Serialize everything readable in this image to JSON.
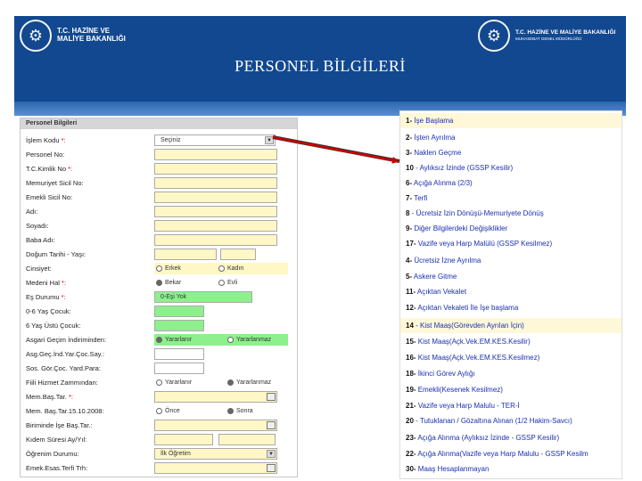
{
  "banner": {
    "left_logo_line1": "T.C. HAZİNE VE",
    "left_logo_line2": "MALİYE BAKANLIĞI",
    "right_logo_line1": "T.C. HAZİNE VE MALİYE BAKANLIĞI",
    "right_logo_line2": "MUHASEBAT GENEL MÜDÜRLÜĞÜ",
    "title": "PERSONEL BİLGİLERİ"
  },
  "form": {
    "header": "Personel Bilgileri",
    "islem_kodu": {
      "label": "İşlem Kodu",
      "value": "Seçiniz"
    },
    "personel_no": "Personel No:",
    "tc_kimlik": "T.C.Kimlik No",
    "memuriyet_sicil": "Memuriyet Sicil No:",
    "emekli_sicil": "Emekli Sicil No:",
    "adi": "Adı:",
    "soyadi": "Soyadı:",
    "baba_adi": "Baba Adı:",
    "dogum": "Doğum Tarihi - Yaşı:",
    "cinsiyet": {
      "label": "Cinsiyet:",
      "opt1": "Erkek",
      "opt2": "Kadın"
    },
    "medeni_hal": {
      "label": "Medeni Hal",
      "opt1": "Bekar",
      "opt2": "Evli"
    },
    "es_durumu": {
      "label": "Eş Durumu",
      "value": "0-Eşi Yok"
    },
    "cocuk_06": "0-6 Yaş Çocuk:",
    "cocuk_6ustu": "6 Yaş Üstü Çocuk:",
    "asgari_gecim": {
      "label": "Asgari Geçim İndiriminden:",
      "opt1": "Yararlanır",
      "opt2": "Yararlanmaz"
    },
    "asg_geç_ind": "Asg.Geç.İnd.Yar.Çoc.Say.:",
    "sos_gor": "Sos. Gör.Çoc. Yard.Para:",
    "fiili_hizmet": {
      "label": "Fiili Hizmet Zammından:",
      "opt1": "Yararlanır",
      "opt2": "Yararlanmaz"
    },
    "mem_bas_tar": "Mem.Baş.Tar.",
    "mem_bas_tar_2008": {
      "label": "Mem. Baş.Tar.15.10.2008:",
      "opt1": "Önce",
      "opt2": "Sonra"
    },
    "birimde_ise_bas": "Biriminde İşe Baş.Tar.:",
    "kidem_suresi": "Kıdem Süresi Ay/Yıl:",
    "ogrenim": {
      "label": "Öğrenim Durumu:",
      "value": "İlk Öğretim"
    },
    "emek_esas": "Emek.Esas.Terfi Trh:"
  },
  "codes": [
    {
      "num": "1-",
      "text": "İşe Başlama"
    },
    {
      "num": "2-",
      "text": "İşten Ayrılma"
    },
    {
      "num": "3-",
      "text": "Naklen Geçme"
    },
    {
      "num": "10",
      "text": "- Aylıksız İzinde (GSSP Kesilir)"
    },
    {
      "num": "6-",
      "text": "Açığa Alınma (2/3)"
    },
    {
      "num": "7-",
      "text": "Terfi"
    },
    {
      "num": "8",
      "text": "- Ücretsiz İzin Dönüşü-Memuriyete Dönüş"
    },
    {
      "num": "9-",
      "text": "Diğer Bilgilerdeki Değişiklikler"
    },
    {
      "num": "17-",
      "text": "Vazife veya Harp Malülü (GSSP Kesilmez)"
    },
    {
      "num": "4-",
      "text": "Ücretsiz İzne Ayrılma"
    },
    {
      "num": "5-",
      "text": "Askere Gitme"
    },
    {
      "num": "11-",
      "text": "Açıktan Vekalet"
    },
    {
      "num": "12-",
      "text": "Açıktan Vekaleti İle İşe başlama"
    },
    {
      "num": "14",
      "text": "- Kist Maaş(Görevden Ayrılan İçin)"
    },
    {
      "num": "15-",
      "text": "Kist Maaş(Açk.Vek.EM.KES.Kesilir)"
    },
    {
      "num": "16-",
      "text": "Kist Maaş(Açk.Vek.EM.KES.Kesilmez)"
    },
    {
      "num": "18-",
      "text": "İkinci Görev Aylığı"
    },
    {
      "num": "19-",
      "text": "Emekli(Kesenek Kesilmez)"
    },
    {
      "num": "21-",
      "text": "Vazife veya Harp Malulu - TER-İ"
    },
    {
      "num": "20",
      "text": "- Tutuklanan / Gözaltına Alınan (1/2 Hakim-Savcı)"
    },
    {
      "num": "23-",
      "text": "Açığa Alınma (Aylıksız İzinde - GSSP Kesilir)"
    },
    {
      "num": "22-",
      "text": "Açığa Alınma(Vazife veya Harp Malulu - GSSP Kesilm"
    },
    {
      "num": "30-",
      "text": "Maaş Hesaplanmayan"
    }
  ],
  "colors": {
    "banner": "#12488f",
    "required_field": "#fff7c5",
    "filled_field": "#8df08d",
    "arrow": "#cc0000",
    "link": "#1b2fb0"
  }
}
